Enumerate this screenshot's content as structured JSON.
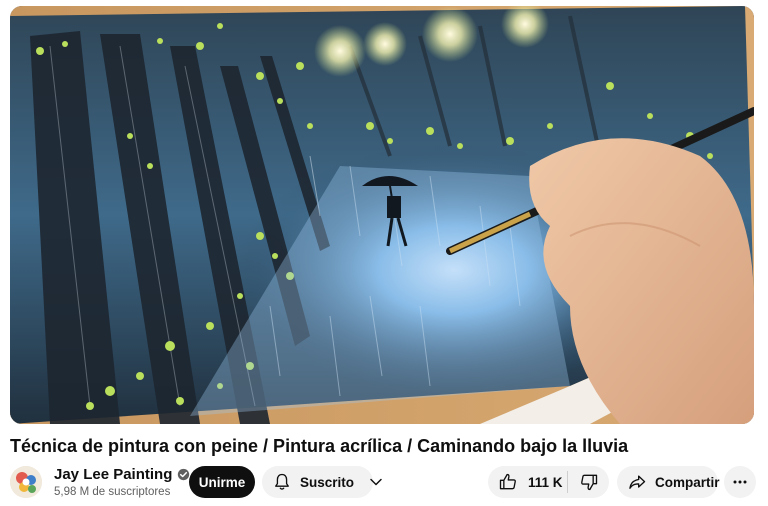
{
  "video": {
    "title": "Técnica de pintura con peine / Pintura acrílica / Caminando bajo la lluvia"
  },
  "channel": {
    "name": "Jay Lee Painting",
    "subscribers": "5,98 M de suscriptores",
    "verified_icon": "verified-check-icon"
  },
  "actions": {
    "join_label": "Unirme",
    "subscribed_label": "Suscrito",
    "like_count": "111 K",
    "share_label": "Compartir"
  },
  "icons": {
    "bell": "bell-icon",
    "chevron": "chevron-down-icon",
    "like": "thumbs-up-icon",
    "dislike": "thumbs-down-icon",
    "share": "share-arrow-icon",
    "more": "more-horizontal-icon"
  },
  "colors": {
    "join_button_bg": "#0f0f0f",
    "pill_bg": "#f2f2f2",
    "secondary_text": "#606060"
  }
}
